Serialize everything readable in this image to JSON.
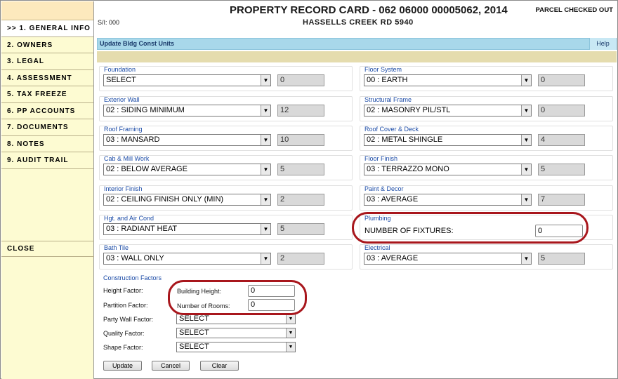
{
  "header": {
    "title": "PROPERTY RECORD CARD - 062 06000 00005062, 2014",
    "subtitle": "HASSELLS CREEK RD 5940",
    "sl": "S/I: 000",
    "status": "PARCEL CHECKED OUT"
  },
  "sidebar": {
    "items": [
      {
        "label": ">> 1. GENERAL INFO"
      },
      {
        "label": "2. OWNERS"
      },
      {
        "label": "3. LEGAL"
      },
      {
        "label": "4. ASSESSMENT"
      },
      {
        "label": "5. TAX FREEZE"
      },
      {
        "label": "6. PP ACCOUNTS"
      },
      {
        "label": "7. DOCUMENTS"
      },
      {
        "label": "8. NOTES"
      },
      {
        "label": "9. AUDIT TRAIL"
      }
    ],
    "close": "CLOSE"
  },
  "section": {
    "title": "Update Bldg Const Units",
    "help": "Help"
  },
  "fields": {
    "foundation": {
      "label": "Foundation",
      "value": "SELECT",
      "code": "0"
    },
    "floor_system": {
      "label": "Floor System",
      "value": "00 : EARTH",
      "code": "0"
    },
    "exterior_wall": {
      "label": "Exterior Wall",
      "value": "02 : SIDING MINIMUM",
      "code": "12"
    },
    "structural_frame": {
      "label": "Structural Frame",
      "value": "02 : MASONRY PIL/STL",
      "code": "0"
    },
    "roof_framing": {
      "label": "Roof Framing",
      "value": "03 : MANSARD",
      "code": "10"
    },
    "roof_cover": {
      "label": "Roof Cover & Deck",
      "value": "02 : METAL SHINGLE",
      "code": "4"
    },
    "cab_mill": {
      "label": "Cab & Mill Work",
      "value": "02 : BELOW AVERAGE",
      "code": "5"
    },
    "floor_finish": {
      "label": "Floor Finish",
      "value": "03 : TERRAZZO MONO",
      "code": "5"
    },
    "interior_finish": {
      "label": "Interior Finish",
      "value": "02 : CEILING FINISH ONLY (MIN)",
      "code": "2"
    },
    "paint_decor": {
      "label": "Paint & Decor",
      "value": "03 : AVERAGE",
      "code": "7"
    },
    "hgt_air": {
      "label": "Hgt. and Air Cond",
      "value": "03 : RADIANT HEAT",
      "code": "5"
    },
    "plumbing": {
      "label": "Plumbing",
      "sublabel": "NUMBER OF FIXTURES:",
      "value": "0"
    },
    "bath_tile": {
      "label": "Bath Tile",
      "value": "03 : WALL ONLY",
      "code": "2"
    },
    "electrical": {
      "label": "Electrical",
      "value": "03 : AVERAGE",
      "code": "5"
    }
  },
  "construction": {
    "title": "Construction Factors",
    "height_factor": "Height Factor:",
    "building_height_label": "Building Height:",
    "building_height": "0",
    "partition_factor": "Partition Factor:",
    "rooms_label": "Number of Rooms:",
    "rooms": "0",
    "party_wall_label": "Party Wall Factor:",
    "party_wall": "SELECT",
    "quality_label": "Quality Factor:",
    "quality": "SELECT",
    "shape_label": "Shape Factor:",
    "shape": "SELECT"
  },
  "buttons": {
    "update": "Update",
    "cancel": "Cancel",
    "clear": "Clear"
  },
  "colors": {
    "sidebar_bg": "#fdfbd2",
    "section_bar": "#a8d8ea",
    "label_blue": "#1a4aa6",
    "highlight": "#a8161c"
  }
}
